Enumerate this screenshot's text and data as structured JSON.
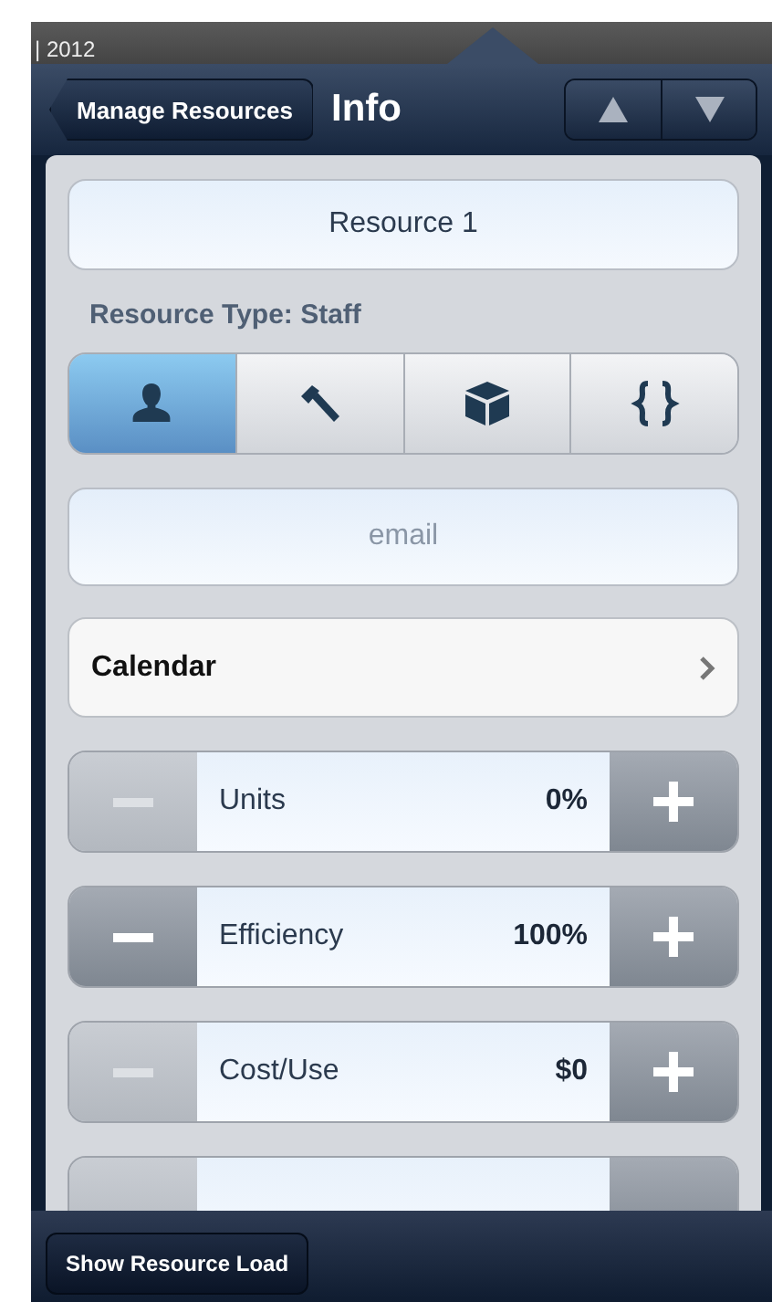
{
  "background": {
    "year_label": "| 2012"
  },
  "header": {
    "back_button": "Manage Resources",
    "title": "Info",
    "nav_buttons": [
      {
        "kind": "up"
      },
      {
        "kind": "down"
      }
    ]
  },
  "name_field": {
    "value": "Resource 1"
  },
  "resource_type": {
    "label": "Resource Type: Staff",
    "segments": [
      {
        "kind": "person",
        "selected": true
      },
      {
        "kind": "hammer",
        "selected": false
      },
      {
        "kind": "cube",
        "selected": false
      },
      {
        "kind": "braces",
        "selected": false
      }
    ]
  },
  "email_field": {
    "placeholder": "email"
  },
  "calendar_row": {
    "label": "Calendar"
  },
  "steppers": [
    {
      "label": "Units",
      "value": "0%",
      "minus_disabled": true
    },
    {
      "label": "Efficiency",
      "value": "100%",
      "minus_disabled": false
    },
    {
      "label": "Cost/Use",
      "value": "$0",
      "minus_disabled": true
    }
  ],
  "more_rows_below": true,
  "bottom_bar": {
    "button": "Show Resource Load"
  }
}
